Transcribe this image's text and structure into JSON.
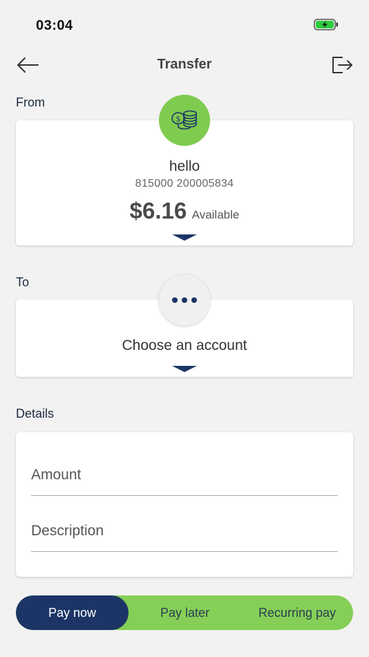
{
  "status_bar": {
    "time": "03:04",
    "battery_icon": "battery-charging-icon",
    "battery_color": "#2ecc40"
  },
  "nav": {
    "title": "Transfer",
    "back_icon": "arrow-left-icon",
    "logout_icon": "logout-icon"
  },
  "from": {
    "label": "From",
    "icon": "coins-icon",
    "account_name": "hello",
    "account_number": "815000 200005834",
    "balance": "$6.16",
    "balance_label": "Available"
  },
  "to": {
    "label": "To",
    "icon": "more-dots-icon",
    "placeholder": "Choose an account"
  },
  "details": {
    "label": "Details",
    "amount_placeholder": "Amount",
    "description_placeholder": "Description"
  },
  "payment_options": {
    "selected": "Pay now",
    "items": [
      "Pay now",
      "Pay later",
      "Recurring pay"
    ]
  },
  "colors": {
    "accent_green": "#85cf58",
    "navy": "#1c3566",
    "background": "#f2f2f2"
  }
}
